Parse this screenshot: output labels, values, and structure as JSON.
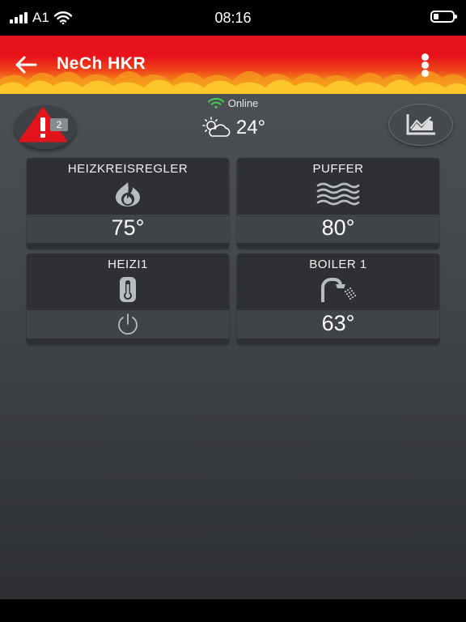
{
  "status_bar": {
    "carrier": "A1",
    "time": "08:16"
  },
  "header": {
    "title": "NeCh HKR"
  },
  "connection": {
    "status": "Online",
    "color": "#3ecf5b"
  },
  "alarm": {
    "count": "2",
    "color": "#e3141c"
  },
  "weather": {
    "temperature": "24°",
    "icon": "partly-cloudy-icon"
  },
  "tiles": [
    {
      "name": "HEIZKREISREGLER",
      "value": "75°",
      "icon": "flame-icon"
    },
    {
      "name": "PUFFER",
      "value": "80°",
      "icon": "waves-icon"
    },
    {
      "name": "HEIZI1",
      "value": "",
      "icon": "thermometer-icon",
      "state_icon": "power-icon"
    },
    {
      "name": "BOILER 1",
      "value": "63°",
      "icon": "shower-icon"
    }
  ]
}
